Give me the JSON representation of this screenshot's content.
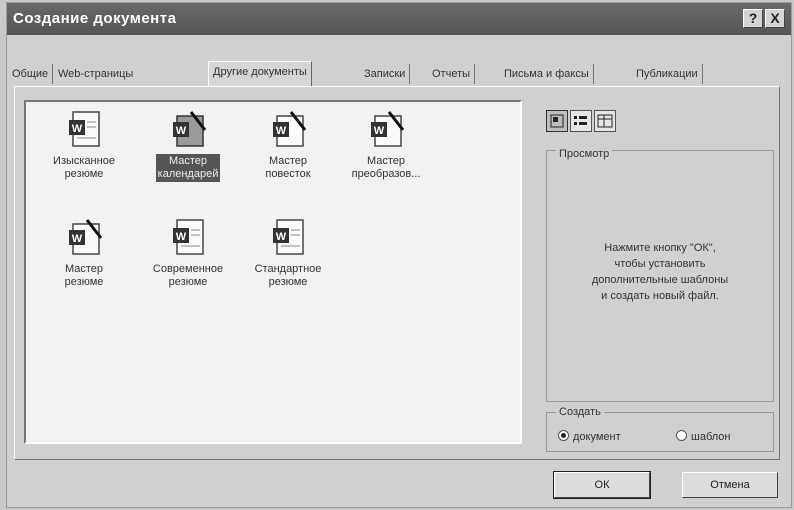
{
  "window": {
    "title": "Создание документа",
    "help_label": "?",
    "close_label": "X"
  },
  "tabs": [
    {
      "label": "Общие"
    },
    {
      "label": "Web-страницы"
    },
    {
      "label": "Другие документы"
    },
    {
      "label": "Записки"
    },
    {
      "label": "Отчеты"
    },
    {
      "label": "Письма и факсы"
    },
    {
      "label": "Публикации"
    }
  ],
  "active_tab": "Другие документы",
  "templates": [
    {
      "line1": "Изысканное",
      "line2": "резюме",
      "icon": "document-icon",
      "selected": false
    },
    {
      "line1": "Мастер",
      "line2": "календарей",
      "icon": "wizard-icon",
      "selected": true
    },
    {
      "line1": "Мастер",
      "line2": "повесток",
      "icon": "wizard-icon",
      "selected": false
    },
    {
      "line1": "Мастер",
      "line2": "преобразов...",
      "icon": "wizard-icon",
      "selected": false
    },
    {
      "line1": "Мастер",
      "line2": "резюме",
      "icon": "wizard-icon",
      "selected": false
    },
    {
      "line1": "Современное",
      "line2": "резюме",
      "icon": "document-icon",
      "selected": false
    },
    {
      "line1": "Стандартное",
      "line2": "резюме",
      "icon": "document-icon",
      "selected": false
    }
  ],
  "view_buttons": [
    "large-icons-view",
    "list-view",
    "details-view"
  ],
  "preview": {
    "label": "Просмотр",
    "message_line1": "Нажмите кнопку \"ОК\",",
    "message_line2": "чтобы установить",
    "message_line3": "дополнительные шаблоны",
    "message_line4": "и создать новый файл."
  },
  "create": {
    "label": "Создать",
    "option_document": "документ",
    "option_template": "шаблон",
    "selected": "документ"
  },
  "buttons": {
    "ok": "ОК",
    "cancel": "Отмена"
  },
  "colors": {
    "titlebar": "#5e5e5e",
    "selection": "#555555"
  }
}
